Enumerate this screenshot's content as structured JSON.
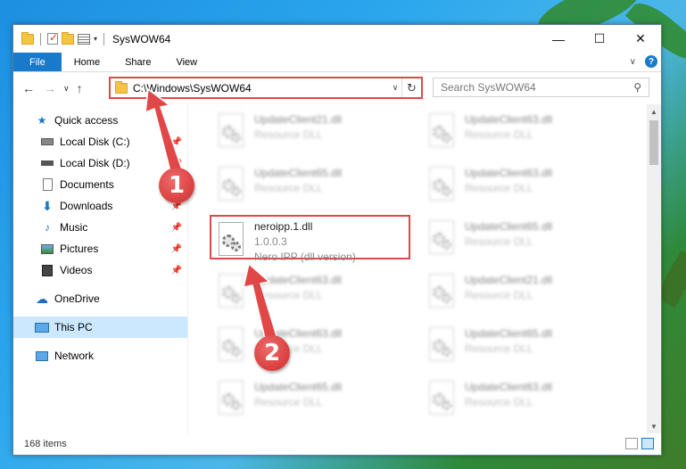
{
  "window": {
    "title": "SysWOW64",
    "controls": {
      "minimize": "—",
      "maximize": "☐",
      "close": "✕"
    }
  },
  "ribbon": {
    "tabs": [
      "File",
      "Home",
      "Share",
      "View"
    ],
    "expand_glyph": "∨",
    "help_glyph": "?"
  },
  "nav": {
    "back": "←",
    "forward": "→",
    "recent": "∨",
    "up": "↑",
    "address": "C:\\Windows\\SysWOW64",
    "search_placeholder": "Search SysWOW64"
  },
  "sidebar": {
    "items": [
      {
        "label": "Quick access",
        "icon": "star-icon",
        "pinned": false
      },
      {
        "label": "Local Disk (C:)",
        "icon": "drive-icon",
        "pinned": true
      },
      {
        "label": "Local Disk (D:)",
        "icon": "drive-icon",
        "pinned": true
      },
      {
        "label": "Documents",
        "icon": "documents-icon",
        "pinned": true
      },
      {
        "label": "Downloads",
        "icon": "download-icon",
        "pinned": true
      },
      {
        "label": "Music",
        "icon": "music-icon",
        "pinned": true
      },
      {
        "label": "Pictures",
        "icon": "pictures-icon",
        "pinned": true
      },
      {
        "label": "Videos",
        "icon": "videos-icon",
        "pinned": true
      },
      {
        "label": "OneDrive",
        "icon": "cloud-icon",
        "pinned": false
      },
      {
        "label": "This PC",
        "icon": "computer-icon",
        "pinned": false,
        "selected": true
      },
      {
        "label": "Network",
        "icon": "network-icon",
        "pinned": false
      }
    ]
  },
  "files": [
    {
      "name": "UpdateClient21.dll",
      "sub": "Resource DLL"
    },
    {
      "name": "UpdateClient63.dll",
      "sub": "Resource DLL"
    },
    {
      "name": "UpdateClient65.dll",
      "sub": "Resource DLL"
    },
    {
      "name": "UpdateClient63.dll",
      "sub": "Resource DLL"
    },
    {
      "name": "neroipp.1.dll",
      "version": "1.0.0.3",
      "sub": "Nero IPP (dll version)",
      "highlighted": true
    },
    {
      "name": "UpdateClient65.dll",
      "sub": "Resource DLL"
    },
    {
      "name": "UpdateClient63.dll",
      "sub": "Resource DLL"
    },
    {
      "name": "UpdateClient21.dll",
      "sub": "Resource DLL"
    },
    {
      "name": "UpdateClient63.dll",
      "sub": "Resource DLL"
    },
    {
      "name": "UpdateClient65.dll",
      "sub": "Resource DLL"
    },
    {
      "name": "UpdateClient65.dll",
      "sub": "Resource DLL"
    },
    {
      "name": "UpdateClient63.dll",
      "sub": "Resource DLL"
    }
  ],
  "status": {
    "item_count": "168 items"
  },
  "markers": {
    "step1": "1",
    "step2": "2"
  },
  "colors": {
    "accent": "#1979ca",
    "highlight": "#e04848",
    "selection": "#cce8ff"
  }
}
